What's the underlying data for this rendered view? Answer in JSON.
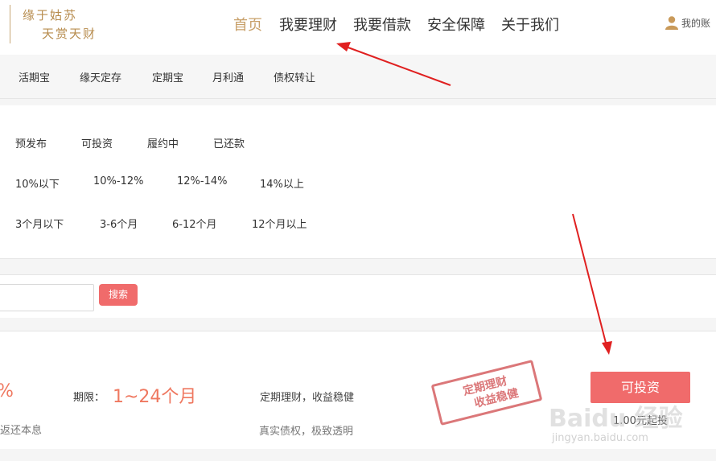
{
  "logo": {
    "line1": "缘于姑苏",
    "line2": "天赏天财"
  },
  "nav": {
    "items": [
      {
        "label": "首页",
        "active": true
      },
      {
        "label": "我要理财",
        "active": false
      },
      {
        "label": "我要借款",
        "active": false
      },
      {
        "label": "安全保障",
        "active": false
      },
      {
        "label": "关于我们",
        "active": false
      }
    ],
    "account_label": "我的账"
  },
  "product_tabs": [
    "活期宝",
    "缘天定存",
    "定期宝",
    "月利通",
    "债权转让"
  ],
  "filters": {
    "status": [
      "预发布",
      "可投资",
      "履约中",
      "已还款"
    ],
    "rate": [
      "10%以下",
      "10%-12%",
      "12%-14%",
      "14%以上"
    ],
    "term": [
      "3个月以下",
      "3-6个月",
      "6-12个月",
      "12个月以上"
    ]
  },
  "search": {
    "button_label": "搜索",
    "placeholder": ""
  },
  "product": {
    "rate_fragment": "%",
    "term_label": "期限：",
    "term_value": "1~24个月",
    "desc1": "定期理财，收益稳健",
    "desc2": "真实债权，极致透明",
    "repay_fragment": "返还本息",
    "invest_label": "可投资",
    "min_buy": "1.00元起投",
    "stamp_line1": "定期理财",
    "stamp_line2": "收益稳健"
  },
  "watermark": {
    "main": "Baidu 经验",
    "sub": "jingyan.baidu.com"
  },
  "colors": {
    "accent": "#f06b6b",
    "nav_active": "#c8a06a",
    "rate": "#ef7860",
    "arrow": "#e02020"
  }
}
